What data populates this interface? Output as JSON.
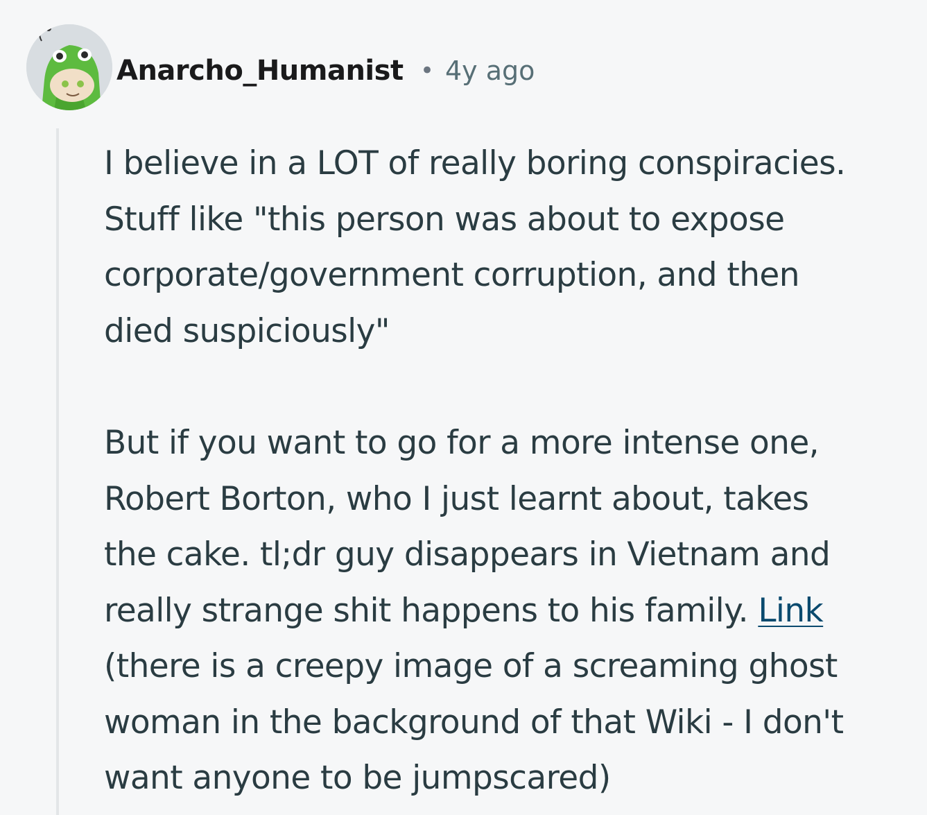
{
  "comment": {
    "author": "Anarcho_Humanist",
    "separator": "•",
    "timestamp": "4y ago",
    "avatar_icon": "snoo-frog-hood-avatar-icon",
    "colors": {
      "background": "#f6f7f8",
      "author": "#1a1a1b",
      "timestamp": "#576f76",
      "body_text": "#2a3c42",
      "link": "#0a4a6e",
      "thread_line": "#e3e6e8"
    },
    "paragraph1": {
      "line1": "I believe in a LOT of really boring conspiracies.",
      "line2": "Stuff like \"this person was about to expose",
      "line3": "corporate/government corruption, and then",
      "line4": "died suspiciously\""
    },
    "paragraph2": {
      "line1": "But if you want to go for a more intense one,",
      "line2": "Robert Borton, who I just learnt about, takes",
      "line3": "the cake. tl;dr guy disappears in Vietnam and",
      "line4_text": "really strange shit happens to his family. ",
      "link_label": "Link",
      "line5": "(there is a creepy image of a screaming ghost",
      "line6": "woman in the background of that Wiki - I don't",
      "line7": "want anyone to be jumpscared)"
    }
  }
}
